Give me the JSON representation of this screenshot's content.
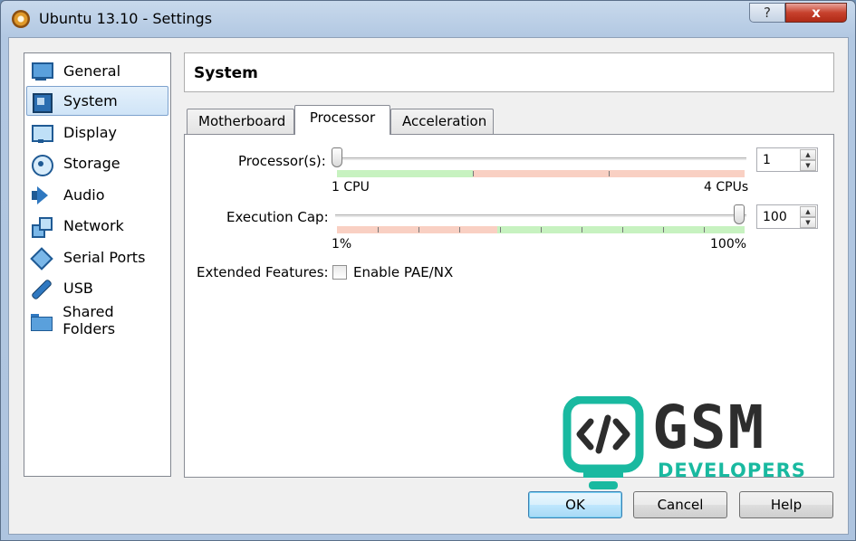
{
  "window": {
    "title": "Ubuntu 13.10 - Settings",
    "help_glyph": "?",
    "close_glyph": "x"
  },
  "sidebar": {
    "items": [
      {
        "label": "General",
        "icon": "monitor-icon",
        "selected": false
      },
      {
        "label": "System",
        "icon": "chip-icon",
        "selected": true
      },
      {
        "label": "Display",
        "icon": "display-icon",
        "selected": false
      },
      {
        "label": "Storage",
        "icon": "storage-icon",
        "selected": false
      },
      {
        "label": "Audio",
        "icon": "speaker-icon",
        "selected": false
      },
      {
        "label": "Network",
        "icon": "network-icon",
        "selected": false
      },
      {
        "label": "Serial Ports",
        "icon": "serial-port-icon",
        "selected": false
      },
      {
        "label": "USB",
        "icon": "usb-icon",
        "selected": false
      },
      {
        "label": "Shared Folders",
        "icon": "folder-icon",
        "selected": false
      }
    ]
  },
  "header": {
    "title": "System"
  },
  "tabs": [
    {
      "label": "Motherboard",
      "active": false
    },
    {
      "label": "Processor",
      "active": true
    },
    {
      "label": "Acceleration",
      "active": false
    }
  ],
  "processor": {
    "processors_label": "Processor(s):",
    "processors_value": "1",
    "processors_min_label": "1 CPU",
    "processors_max_label": "4 CPUs",
    "processors_min": 1,
    "processors_max": 4,
    "processors_safe_max": 2,
    "exec_cap_label": "Execution Cap:",
    "exec_cap_value": "100",
    "exec_cap_min_label": "1%",
    "exec_cap_max_label": "100%",
    "exec_cap_min": 1,
    "exec_cap_max": 100,
    "exec_cap_safe_min": 40,
    "extended_features_label": "Extended Features:",
    "pae_label": "Enable PAE/NX",
    "pae_checked": false
  },
  "watermark": {
    "line1": "GSM",
    "line2": "DEVELOPERS"
  },
  "colors": {
    "range_ok": "#c7f2c0",
    "range_warn": "#f9d0c3",
    "selection_border": "#7da2ce",
    "watermark_accent": "#19b9a0"
  },
  "buttons": {
    "ok": "OK",
    "cancel": "Cancel",
    "help": "Help"
  }
}
